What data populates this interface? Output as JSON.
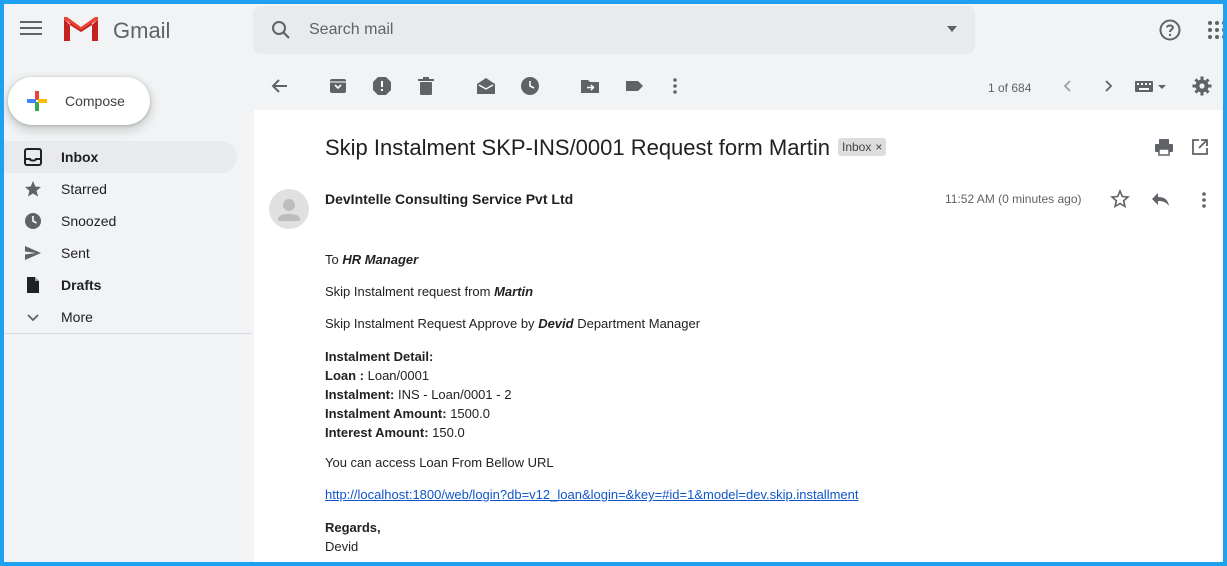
{
  "app": {
    "name": "Gmail"
  },
  "search": {
    "placeholder": "Search mail"
  },
  "compose": {
    "label": "Compose"
  },
  "sidebar": {
    "items": [
      {
        "label": "Inbox",
        "icon": "inbox-icon",
        "active": true,
        "bold": true
      },
      {
        "label": "Starred",
        "icon": "star-icon"
      },
      {
        "label": "Snoozed",
        "icon": "clock-icon"
      },
      {
        "label": "Sent",
        "icon": "send-icon"
      },
      {
        "label": "Drafts",
        "icon": "draft-icon",
        "bold": true
      },
      {
        "label": "More",
        "icon": "chevron-down-icon"
      }
    ]
  },
  "toolbar": {
    "pager": "1 of 684",
    "icons": [
      "back-arrow-icon",
      "archive-icon",
      "report-spam-icon",
      "delete-icon",
      "mark-unread-icon",
      "snooze-icon",
      "move-to-icon",
      "label-icon",
      "more-vert-icon",
      "older-chevron-icon",
      "newer-chevron-icon",
      "keyboard-icon",
      "settings-icon"
    ]
  },
  "message": {
    "subject": "Skip Instalment SKP-INS/0001 Request form Martin",
    "label": "Inbox",
    "label_close": "×",
    "sender": "DevIntelle Consulting Service Pvt Ltd",
    "time": "11:52 AM (0 minutes ago)",
    "body": {
      "to_prefix": "To ",
      "to_name": "HR Manager",
      "request_prefix": "Skip Instalment request from ",
      "request_name": "Martin",
      "approve_prefix": "Skip Instalment Request Approve by ",
      "approve_name": "Devid",
      "approve_suffix": " Department Manager",
      "detail_heading": "Instalment Detail:",
      "loan_label": "Loan : ",
      "loan_value": "Loan/0001",
      "instalment_label": "Instalment: ",
      "instalment_value": "INS - Loan/0001 - 2",
      "amount_label": "Instalment Amount: ",
      "amount_value": "1500.0",
      "interest_label": "Interest Amount: ",
      "interest_value": "150.0",
      "access_text": "You can access Loan From Bellow URL",
      "url": "http://localhost:1800/web/login?db=v12_loan&login=&key=#id=1&model=dev.skip.installment",
      "regards": "Regards,",
      "signature": "Devid"
    }
  },
  "colors": {
    "accent_border": "#1fa0f0",
    "link": "#1155cc",
    "active_nav": "#e8eaed"
  }
}
